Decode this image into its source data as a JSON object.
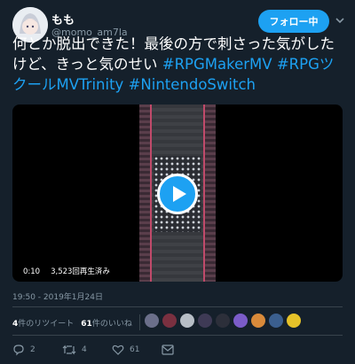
{
  "user": {
    "display_name": "もも",
    "handle": "@momo_am7la",
    "follow_label": "フォロー中"
  },
  "tweet": {
    "text": "何とか脱出できた！最後の方で刺さった気がしたけど、きっと気のせい",
    "hashtags": [
      "#RPGMakerMV",
      "#RPGツクールMVTrinity",
      "#NintendoSwitch"
    ]
  },
  "video": {
    "duration": "0:10",
    "views": "3,523回再生済み"
  },
  "timestamp": "19:50 - 2019年1月24日",
  "stats": {
    "retweets_count": "4",
    "retweets_label": "件のリツイート",
    "likes_count": "61",
    "likes_label": "件のいいね"
  },
  "likers": [
    "#6b6f8a",
    "#7a3040",
    "#b7bec6",
    "#3e3a55",
    "#2c2f3a",
    "#7b5cc9",
    "#d98a3a",
    "#3b5f8f",
    "#e6c229"
  ],
  "actions": {
    "reply_count": "2",
    "retweet_count": "4",
    "like_count": "61"
  },
  "colors": {
    "accent": "#1da1f2",
    "background": "#15202b",
    "muted": "#8899a6"
  }
}
